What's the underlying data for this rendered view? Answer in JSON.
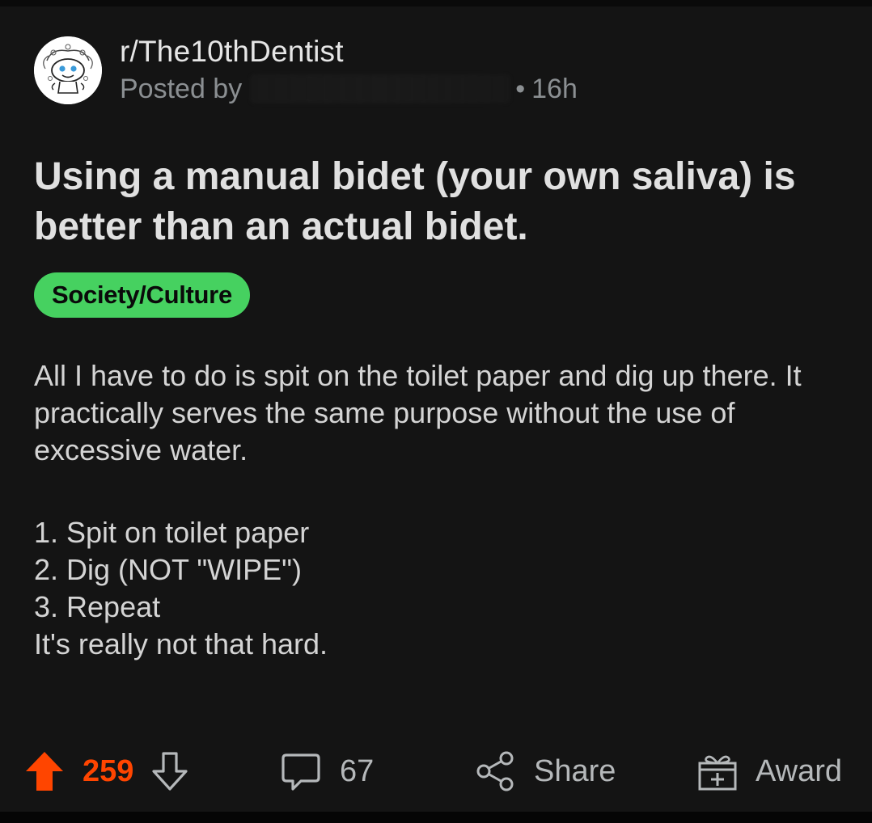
{
  "post": {
    "subreddit": "r/The10thDentist",
    "posted_by_label": "Posted by",
    "age_separator": "•",
    "age": "16h",
    "title": "Using a manual bidet (your own saliva) is better than an actual bidet.",
    "flair": "Society/Culture",
    "body": {
      "paragraph": "All I have to do is spit on the toilet paper and dig up there.  It practically serves the same purpose without the use of excessive water.",
      "steps": [
        "1. Spit on toilet paper",
        "2. Dig (NOT \"WIPE\")",
        "3. Repeat"
      ],
      "closing": "It's really not that hard."
    }
  },
  "actions": {
    "upvotes": "259",
    "comments": "67",
    "share_label": "Share",
    "award_label": "Award"
  },
  "colors": {
    "upvote": "#ff4500",
    "flair": "#46d160",
    "background": "#141414"
  }
}
